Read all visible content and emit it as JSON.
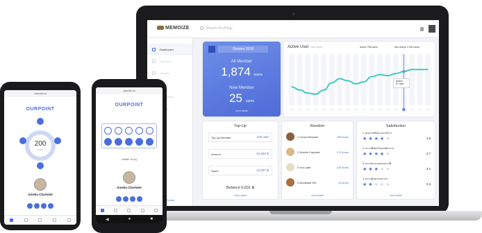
{
  "laptop": {
    "app_logo": "MEMOIZE",
    "search_placeholder": "Search Anything...",
    "sidebar": {
      "items": [
        {
          "label": "Dashboard",
          "active": true
        },
        {
          "label": "List Price",
          "active": false
        },
        {
          "label": "Member",
          "active": false
        },
        {
          "label": "Report",
          "active": false
        },
        {
          "label": "Transaction",
          "active": false
        },
        {
          "label": "Setting",
          "active": false
        }
      ],
      "footer_links": "CRM | Help Center"
    },
    "summary": {
      "date": "October 2019",
      "all_member_label": "All Member",
      "all_member_value": "1,874",
      "all_member_unit": "users",
      "new_member_label": "New Member",
      "new_member_value": "25",
      "new_member_unit": "users",
      "more": "more detail"
    },
    "active_user": {
      "title": "Active User",
      "subtitle": "this week",
      "legend_active": "Active 796 users",
      "legend_inactive": "Non Active 1,000 users",
      "tooltip_label": "Active",
      "tooltip_value": "87 user",
      "chart_data": {
        "type": "area",
        "title": "Active User",
        "values": [
          36,
          30,
          24,
          22,
          30,
          44,
          52,
          48,
          42,
          46,
          56,
          60,
          58,
          62,
          66,
          70,
          70,
          70
        ],
        "ylim": [
          0,
          100
        ],
        "grid": false,
        "accent": "#3fc8c0"
      }
    },
    "topup": {
      "title": "Top-Up",
      "rows": [
        {
          "label": "Top-Up Member",
          "value": "478 user"
        },
        {
          "label": "Amount",
          "value": "20,900 ฿"
        },
        {
          "label": "Spent",
          "value": "14,097 ฿"
        }
      ],
      "balance": "Balance 6,831 ฿",
      "more": "more detail"
    },
    "redeem": {
      "title": "Reedem",
      "rows": [
        {
          "label": "1 Choco Brownie",
          "value": "785 times"
        },
        {
          "label": "2 Nutella Cupcake",
          "value": "170 times"
        },
        {
          "label": "3 Hot Latte",
          "value": "148 times"
        },
        {
          "label": "4 Breakfast Set",
          "value": "12 times"
        }
      ],
      "more": "more detail"
    },
    "satisfaction": {
      "title": "Satisfaction",
      "rows": [
        {
          "label": "1. คุณภาพสินค้าและบริการ",
          "stars": 4,
          "value": "4.8"
        },
        {
          "label": "2. ความพึงพอใจของพนักงาน",
          "stars": 4,
          "value": "3.7"
        },
        {
          "label": "3. ความสะอาดของสถานที่",
          "stars": 3,
          "value": "3.2"
        },
        {
          "label": "4. ความคุ้มค่าของราคา",
          "stars": 2,
          "value": "2.9"
        }
      ],
      "more": "more detail"
    }
  },
  "phone_left": {
    "url": "ourpoint.co",
    "brand": "OURPOINT",
    "points": "200",
    "points_unit": "POINT",
    "name": "Amelia Charlotte"
  },
  "phone_right": {
    "url": "ourpoint.co",
    "brand": "OURPOINT",
    "name": "Amelia Charlotte",
    "caption": "Natalie Young"
  }
}
